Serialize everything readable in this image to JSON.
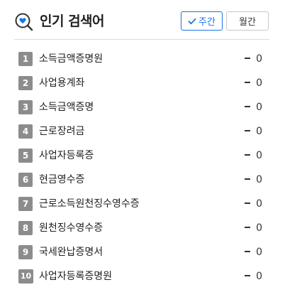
{
  "header": {
    "title": "인기 검색어",
    "icon": "search-heart-icon"
  },
  "tabs": {
    "weekly_label": "주간",
    "monthly_label": "월간",
    "selected": "weekly"
  },
  "colors": {
    "accent": "#1a73e8",
    "rank_badge": "#8c8c8c",
    "heart": "#1a73e8"
  },
  "rankings": [
    {
      "rank": "1",
      "term": "소득금액증명원",
      "change": "0"
    },
    {
      "rank": "2",
      "term": "사업용계좌",
      "change": "0"
    },
    {
      "rank": "3",
      "term": "소득금액증명",
      "change": "0"
    },
    {
      "rank": "4",
      "term": "근로장려금",
      "change": "0"
    },
    {
      "rank": "5",
      "term": "사업자등록증",
      "change": "0"
    },
    {
      "rank": "6",
      "term": "현금영수증",
      "change": "0"
    },
    {
      "rank": "7",
      "term": "근로소득원천징수영수증",
      "change": "0"
    },
    {
      "rank": "8",
      "term": "원천징수영수증",
      "change": "0"
    },
    {
      "rank": "9",
      "term": "국세완납증명서",
      "change": "0"
    },
    {
      "rank": "10",
      "term": "사업자등록증명원",
      "change": "0"
    }
  ]
}
